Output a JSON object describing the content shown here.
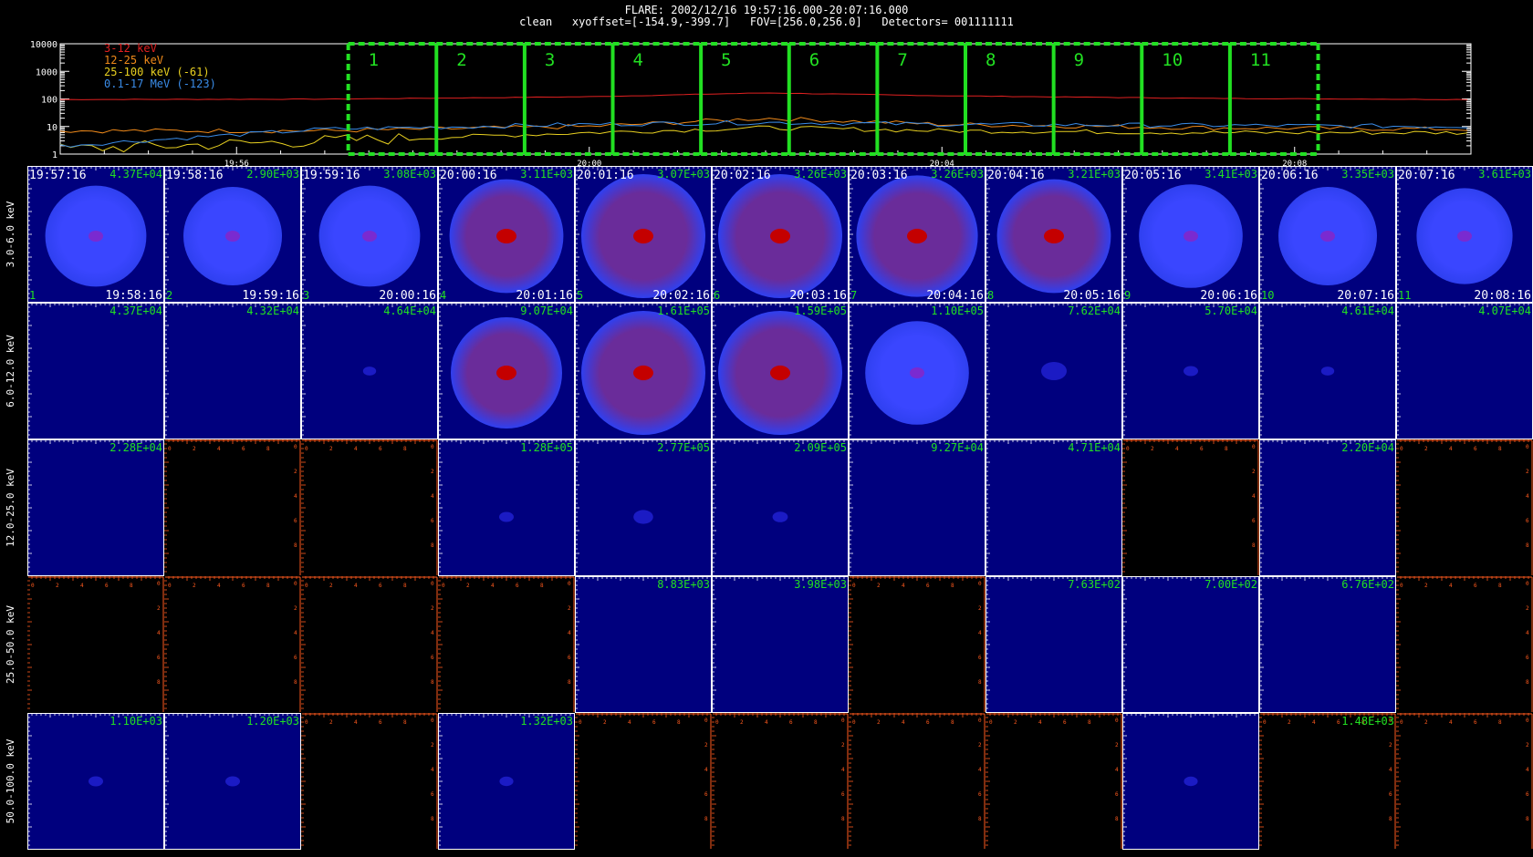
{
  "header": {
    "title": "FLARE: 2002/12/16 19:57:16.000-20:07:16.000",
    "subtitle": "clean   xyoffset=[-154.9,-399.7]   FOV=[256.0,256.0]   Detectors= 001111111"
  },
  "lightcurve": {
    "y_ticks": [
      "10000",
      "1000",
      "100",
      "10",
      "1"
    ],
    "x_ticks": [
      "19:56",
      "20:00",
      "20:04",
      "20:08"
    ],
    "interval_labels": [
      "1",
      "2",
      "3",
      "4",
      "5",
      "6",
      "7",
      "8",
      "9",
      "10",
      "11"
    ],
    "legend": [
      {
        "label": "3-12 keV",
        "color": "#e02020"
      },
      {
        "label": "12-25 keV",
        "color": "#f08a1a"
      },
      {
        "label": "25-100 keV (-61)",
        "color": "#e8d020"
      },
      {
        "label": "0.1-17 MeV (-123)",
        "color": "#3a8ce8"
      }
    ],
    "interval_color": "#22e022"
  },
  "chart_data": [
    {
      "type": "line",
      "title": "",
      "xlabel": "",
      "ylabel": "",
      "y_scale": "log",
      "ylim": [
        1,
        10000
      ],
      "x_ticks": [
        "19:56",
        "20:00",
        "20:04",
        "20:08"
      ],
      "x_range": [
        "19:54",
        "20:10"
      ],
      "legend_position": "top-left",
      "series": [
        {
          "name": "3-12 keV",
          "color": "#e02020",
          "x": [
            "19:54",
            "19:57",
            "20:00",
            "20:02",
            "20:04",
            "20:07",
            "20:10"
          ],
          "values": [
            95,
            98,
            120,
            165,
            130,
            105,
            95
          ]
        },
        {
          "name": "12-25 keV",
          "color": "#f08a1a",
          "x": [
            "19:54",
            "19:57",
            "20:00",
            "20:02",
            "20:04",
            "20:07",
            "20:10"
          ],
          "values": [
            7,
            7,
            10,
            20,
            12,
            9,
            8
          ]
        },
        {
          "name": "25-100 keV (-61)",
          "color": "#e8d020",
          "x": [
            "19:54",
            "19:57",
            "20:00",
            "20:02",
            "20:04",
            "20:07",
            "20:10"
          ],
          "values": [
            1.5,
            3,
            6,
            9,
            7,
            6,
            6
          ]
        },
        {
          "name": "0.1-17 MeV (-123)",
          "color": "#3a8ce8",
          "x": [
            "19:54",
            "19:57",
            "20:00",
            "20:02",
            "20:04",
            "20:07",
            "20:10"
          ],
          "values": [
            2,
            8,
            12,
            14,
            12,
            11,
            10
          ]
        }
      ],
      "intervals": [
        {
          "label": "1",
          "start": "19:57:16",
          "end": "19:58:16"
        },
        {
          "label": "2",
          "start": "19:58:16",
          "end": "19:59:16"
        },
        {
          "label": "3",
          "start": "19:59:16",
          "end": "20:00:16"
        },
        {
          "label": "4",
          "start": "20:00:16",
          "end": "20:01:16"
        },
        {
          "label": "5",
          "start": "20:01:16",
          "end": "20:02:16"
        },
        {
          "label": "6",
          "start": "20:02:16",
          "end": "20:03:16"
        },
        {
          "label": "7",
          "start": "20:03:16",
          "end": "20:04:16"
        },
        {
          "label": "8",
          "start": "20:04:16",
          "end": "20:05:16"
        },
        {
          "label": "9",
          "start": "20:05:16",
          "end": "20:06:16"
        },
        {
          "label": "10",
          "start": "20:06:16",
          "end": "20:07:16"
        },
        {
          "label": "11",
          "start": "20:07:16",
          "end": "20:08:16"
        }
      ]
    },
    {
      "type": "heatmap",
      "title": "",
      "energy_bands": [
        "3.0-6.0 keV",
        "6.0-12.0 keV",
        "12.0-25.0 keV",
        "25.0-50.0 keV",
        "50.0-100.0 keV"
      ],
      "start_times": [
        "19:57:16",
        "19:58:16",
        "19:59:16",
        "20:00:16",
        "20:01:16",
        "20:02:16",
        "20:03:16",
        "20:04:16",
        "20:05:16",
        "20:06:16",
        "20:07:16"
      ],
      "end_times": [
        "19:58:16",
        "19:59:16",
        "20:00:16",
        "20:01:16",
        "20:02:16",
        "20:03:16",
        "20:04:16",
        "20:05:16",
        "20:06:16",
        "20:07:16",
        "20:08:16"
      ],
      "interval_numbers": [
        "1",
        "2",
        "3",
        "4",
        "5",
        "6",
        "7",
        "8",
        "9",
        "10",
        "11"
      ],
      "peak_values": [
        [
          "4.37E+04",
          "2.90E+03",
          "3.08E+03",
          "3.11E+03",
          "3.07E+03",
          "3.26E+03",
          "3.26E+03",
          "3.21E+03",
          "3.41E+03",
          "3.35E+03",
          "3.61E+03"
        ],
        [
          "4.37E+04",
          "4.32E+04",
          "4.64E+04",
          "9.07E+04",
          "1.61E+05",
          "1.59E+05",
          "1.10E+05",
          "7.62E+04",
          "5.70E+04",
          "4.61E+04",
          "4.07E+04"
        ],
        [
          "2.28E+04",
          "",
          "",
          "1.28E+05",
          "2.77E+05",
          "2.09E+05",
          "9.27E+04",
          "4.71E+04",
          "",
          "2.20E+04",
          ""
        ],
        [
          "",
          "",
          "",
          "",
          "8.83E+03",
          "3.98E+03",
          "",
          "7.63E+02",
          "7.00E+02",
          "6.76E+02",
          ""
        ],
        [
          "1.10E+03",
          "1.20E+03",
          "",
          "1.32E+03",
          "",
          "",
          "",
          "",
          "",
          "1.48E+03",
          ""
        ]
      ],
      "empty_axis_ticks": [
        "0",
        "2",
        "4",
        "6",
        "8"
      ],
      "source_intensity": [
        [
          0.55,
          0.5,
          0.55,
          0.8,
          1.0,
          1.0,
          0.95,
          0.8,
          0.6,
          0.5,
          0.45
        ],
        [
          0,
          0,
          0.03,
          0.75,
          1.0,
          1.0,
          0.6,
          0.2,
          0.05,
          0.03,
          0
        ],
        [
          0,
          -1,
          -1,
          0.05,
          0.12,
          0.06,
          0,
          0,
          -1,
          0,
          -1
        ],
        [
          -1,
          -1,
          -1,
          -1,
          0,
          0,
          -1,
          0,
          0,
          0,
          -1
        ],
        [
          0.05,
          0.05,
          -1,
          0.04,
          -1,
          -1,
          -1,
          -1,
          0.04,
          -1,
          -1
        ]
      ]
    }
  ]
}
